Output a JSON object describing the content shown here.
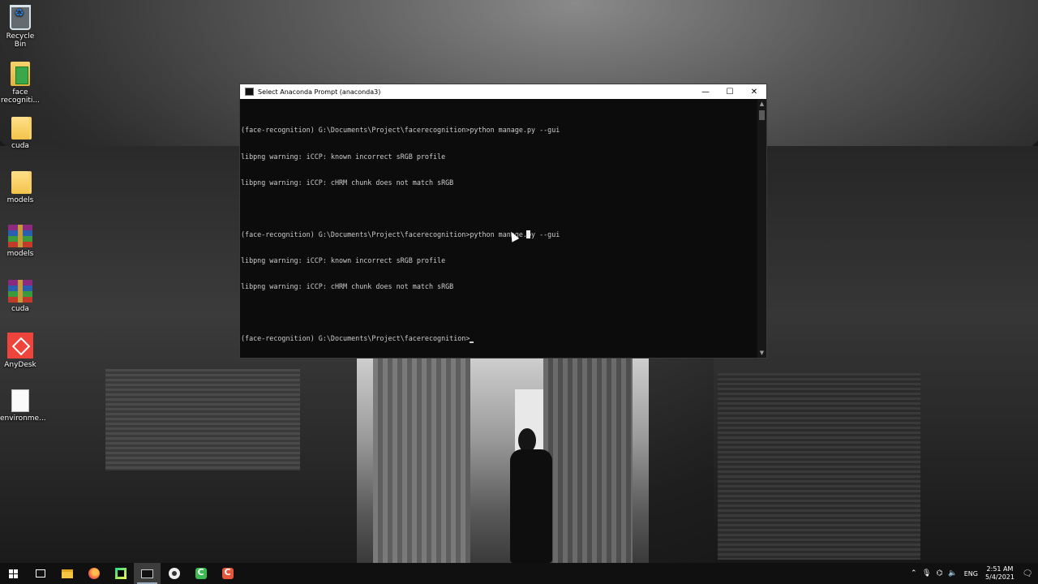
{
  "desktop": {
    "icons": [
      {
        "label": "Recycle Bin",
        "icon": "recycle-bin-icon"
      },
      {
        "label": "face\nrecogniti...",
        "icon": "face-recognition-folder-icon"
      },
      {
        "label": "cuda",
        "icon": "folder-icon"
      },
      {
        "label": "models",
        "icon": "folder-icon"
      },
      {
        "label": "models",
        "icon": "winrar-archive-icon"
      },
      {
        "label": "cuda",
        "icon": "winrar-archive-icon"
      },
      {
        "label": "AnyDesk",
        "icon": "anydesk-icon"
      },
      {
        "label": "environme...",
        "icon": "document-icon"
      }
    ]
  },
  "console": {
    "title": "Select Anaconda Prompt (anaconda3)",
    "lines": [
      "(face-recognition) G:\\Documents\\Project\\facerecognition>python manage.py --gui",
      "libpng warning: iCCP: known incorrect sRGB profile",
      "libpng warning: iCCP: cHRM chunk does not match sRGB",
      "",
      "(face-recognition) G:\\Documents\\Project\\facerecognition>python manage.py --gui",
      "libpng warning: iCCP: known incorrect sRGB profile",
      "libpng warning: iCCP: cHRM chunk does not match sRGB",
      "",
      "(face-recognition) G:\\Documents\\Project\\facerecognition>"
    ],
    "minimize_glyph": "—",
    "maximize_glyph": "☐",
    "close_glyph": "✕"
  },
  "taskbar": {
    "apps": [
      {
        "name": "start",
        "icon": "windows-start-icon"
      },
      {
        "name": "task-view",
        "icon": "task-view-icon"
      },
      {
        "name": "file-explorer",
        "icon": "file-explorer-icon"
      },
      {
        "name": "firefox",
        "icon": "firefox-icon"
      },
      {
        "name": "pycharm",
        "icon": "pycharm-icon"
      },
      {
        "name": "anaconda-prompt",
        "icon": "command-prompt-icon",
        "active": true
      },
      {
        "name": "chrome",
        "icon": "chrome-icon"
      },
      {
        "name": "camtasia-recorder",
        "icon": "camtasia-icon"
      },
      {
        "name": "camtasia",
        "icon": "camtasia-icon"
      }
    ],
    "tray": {
      "language": "ENG",
      "time": "2:51 AM",
      "date": "5/4/2021"
    }
  },
  "colors": {
    "console_bg": "#0c0c0c",
    "console_text": "#cccccc",
    "taskbar_bg": "#101010"
  }
}
